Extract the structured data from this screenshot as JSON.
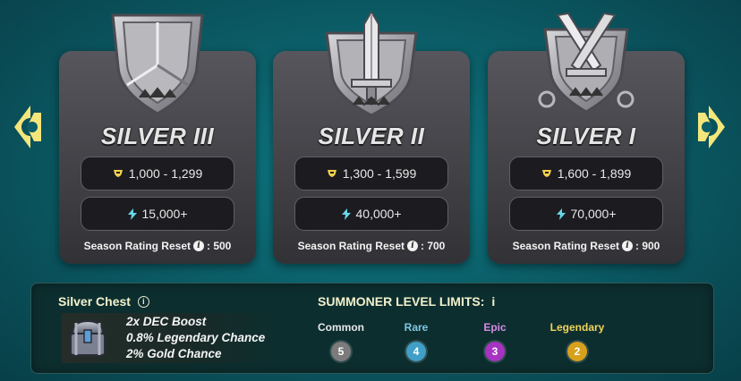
{
  "nav": {
    "prev_icon": "chevron-left-icon",
    "next_icon": "chevron-right-icon",
    "color": "#f4e67a"
  },
  "leagues": [
    {
      "name": "SILVER III",
      "rating_range": "1,000 - 1,299",
      "power": "15,000+",
      "reset_label": "Season Rating Reset",
      "reset_value": ": 500",
      "emblem": "silver-shield-emblem"
    },
    {
      "name": "SILVER II",
      "rating_range": "1,300 - 1,599",
      "power": "40,000+",
      "reset_label": "Season Rating Reset",
      "reset_value": ": 700",
      "emblem": "silver-sword-shield-emblem"
    },
    {
      "name": "SILVER I",
      "rating_range": "1,600 - 1,899",
      "power": "70,000+",
      "reset_label": "Season Rating Reset",
      "reset_value": ": 900",
      "emblem": "silver-crossed-swords-emblem"
    }
  ],
  "chest": {
    "title": "Silver Chest",
    "lines": [
      "2x DEC Boost",
      "0.8% Legendary Chance",
      "2% Gold Chance"
    ]
  },
  "limits": {
    "title": "SUMMONER LEVEL LIMITS:",
    "items": [
      {
        "label": "Common",
        "value": "5",
        "label_color": "#e8e8e8",
        "circle_color": "#7b7b7b"
      },
      {
        "label": "Rare",
        "value": "4",
        "label_color": "#7ec8e3",
        "circle_color": "#3f9fc7"
      },
      {
        "label": "Epic",
        "value": "3",
        "label_color": "#d58ce6",
        "circle_color": "#a733c2"
      },
      {
        "label": "Legendary",
        "value": "2",
        "label_color": "#f0d45a",
        "circle_color": "#d8a11c"
      }
    ]
  },
  "colors": {
    "rating_icon": "#f2d04d",
    "power_icon": "#68d7e8"
  }
}
